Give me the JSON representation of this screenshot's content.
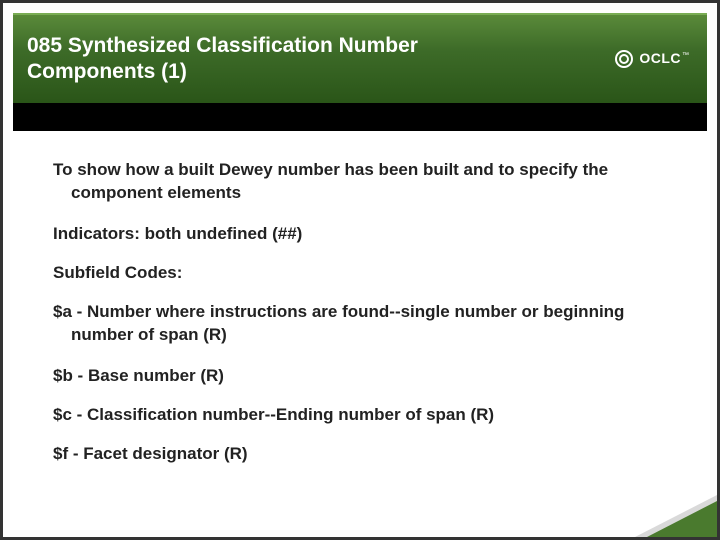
{
  "header": {
    "title": "085 Synthesized Classification Number Components (1)",
    "logo_text": "OCLC",
    "logo_tm": "™"
  },
  "content": {
    "p1": "To show how a built Dewey number has been built and to specify the component elements",
    "p2": "Indicators: both undefined (##)",
    "p3": "Subfield Codes:",
    "p4": "$a - Number where instructions are found--single number or beginning  number of span (R)",
    "p5": "$b - Base number (R)",
    "p6": "$c - Classification number--Ending number of span (R)",
    "p7": "$f - Facet designator (R)"
  }
}
